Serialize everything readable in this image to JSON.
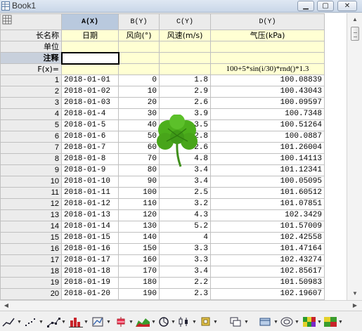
{
  "window": {
    "title": "Book1",
    "min_glyph": "▁",
    "max_glyph": "▢",
    "close_glyph": "✕"
  },
  "corner_icon": "spreadsheet-icon",
  "columns": [
    {
      "id": "A(X)",
      "longname": "日期",
      "unit": "",
      "comment": "",
      "fx": ""
    },
    {
      "id": "B(Y)",
      "longname": "风向(°)",
      "unit": "",
      "comment": "",
      "fx": ""
    },
    {
      "id": "C(Y)",
      "longname": "风速(m/s)",
      "unit": "",
      "comment": "",
      "fx": ""
    },
    {
      "id": "D(Y)",
      "longname": "气压(kPa)",
      "unit": "",
      "comment": "",
      "fx": "100+5*sin(i/30)*rnd()*1.3"
    }
  ],
  "meta_labels": {
    "longname": "长名称",
    "unit": "单位",
    "comment": "注释",
    "fx": "F(x)="
  },
  "rows": [
    {
      "n": "1",
      "date": "2018-01-01",
      "dir": "0",
      "speed": "1.8",
      "pressure": "100.08839"
    },
    {
      "n": "2",
      "date": "2018-01-02",
      "dir": "10",
      "speed": "2.9",
      "pressure": "100.43043"
    },
    {
      "n": "3",
      "date": "2018-01-03",
      "dir": "20",
      "speed": "2.6",
      "pressure": "100.09597"
    },
    {
      "n": "4",
      "date": "2018-01-4",
      "dir": "30",
      "speed": "3.9",
      "pressure": "100.7348"
    },
    {
      "n": "5",
      "date": "2018-01-5",
      "dir": "40",
      "speed": "3.5",
      "pressure": "100.51264"
    },
    {
      "n": "6",
      "date": "2018-01-6",
      "dir": "50",
      "speed": "2.8",
      "pressure": "100.0887"
    },
    {
      "n": "7",
      "date": "2018-01-7",
      "dir": "60",
      "speed": "2.6",
      "pressure": "101.26004"
    },
    {
      "n": "8",
      "date": "2018-01-8",
      "dir": "70",
      "speed": "4.8",
      "pressure": "100.14113"
    },
    {
      "n": "9",
      "date": "2018-01-9",
      "dir": "80",
      "speed": "3.4",
      "pressure": "101.12341"
    },
    {
      "n": "10",
      "date": "2018-01-10",
      "dir": "90",
      "speed": "3.4",
      "pressure": "100.05095"
    },
    {
      "n": "11",
      "date": "2018-01-11",
      "dir": "100",
      "speed": "2.5",
      "pressure": "101.60512"
    },
    {
      "n": "12",
      "date": "2018-01-12",
      "dir": "110",
      "speed": "3.2",
      "pressure": "101.07851"
    },
    {
      "n": "13",
      "date": "2018-01-13",
      "dir": "120",
      "speed": "4.3",
      "pressure": "102.3429"
    },
    {
      "n": "14",
      "date": "2018-01-14",
      "dir": "130",
      "speed": "5.2",
      "pressure": "101.57009"
    },
    {
      "n": "15",
      "date": "2018-01-15",
      "dir": "140",
      "speed": "4",
      "pressure": "102.42558"
    },
    {
      "n": "16",
      "date": "2018-01-16",
      "dir": "150",
      "speed": "3.3",
      "pressure": "101.47164"
    },
    {
      "n": "17",
      "date": "2018-01-17",
      "dir": "160",
      "speed": "3.3",
      "pressure": "102.43274"
    },
    {
      "n": "18",
      "date": "2018-01-18",
      "dir": "170",
      "speed": "3.4",
      "pressure": "102.85617"
    },
    {
      "n": "19",
      "date": "2018-01-19",
      "dir": "180",
      "speed": "2.2",
      "pressure": "101.50983"
    },
    {
      "n": "20",
      "date": "2018-01-20",
      "dir": "190",
      "speed": "2.3",
      "pressure": "102.19607"
    }
  ],
  "toolbar_icons": [
    "line-plot-icon",
    "scatter-plot-icon",
    "line-symbol-plot-icon",
    "column-plot-icon",
    "plot-3d-icon",
    "box-chart-icon",
    "area-plot-icon",
    "pie-chart-icon",
    "stock-chart-icon",
    "layer-icon",
    "stack-icon",
    "template-icon",
    "contour-icon",
    "heatmap-icon",
    "color-map-icon"
  ],
  "colors": {
    "header_selected": "#b9c9de",
    "meta_bg": "#ffffd3",
    "clover_green": "#4caf1c"
  }
}
